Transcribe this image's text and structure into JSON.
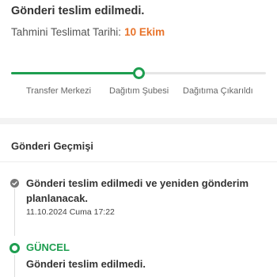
{
  "status": {
    "title": "Gönderi teslim edilmedi.",
    "eta_label": "Tahmini Teslimat Tarihi:",
    "eta_date": "10 Ekim",
    "eta_color": "#e8732a"
  },
  "progress": {
    "fraction": 0.5,
    "color": "#1e9e50",
    "steps": [
      "Transfer Merkezi",
      "Dağıtım Şubesi",
      "Dağıtıma Çıkarıldı"
    ]
  },
  "history": {
    "title": "Gönderi Geçmişi",
    "events": [
      {
        "icon": "check-circle-icon",
        "text": "Gönderi teslim edilmedi ve yeniden gönderim planlanacak.",
        "date": "11.10.2024 Cuma 17:22"
      }
    ],
    "current": {
      "icon": "current-status-icon",
      "label": "GÜNCEL",
      "text": "Gönderi teslim edilmedi."
    }
  }
}
